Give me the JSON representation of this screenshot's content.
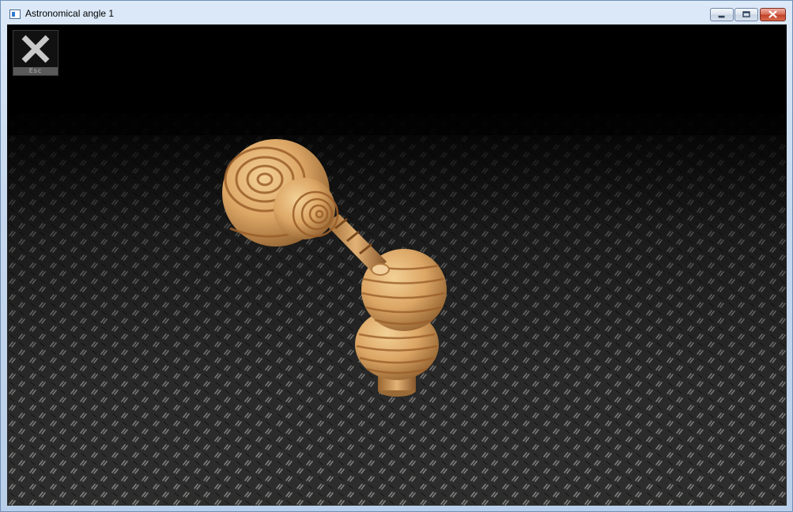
{
  "window": {
    "title": "Astronomical angle 1",
    "icon": "app-window-icon",
    "controls": {
      "minimize": "minimize-icon",
      "maximize": "maximize-icon",
      "close": "close-icon"
    }
  },
  "overlay": {
    "escape_button": {
      "label": "Esc",
      "icon": "x-close-icon"
    }
  },
  "scene": {
    "object": "wooden-telescope-model",
    "floor": "metal-diamond-plate-floor"
  }
}
